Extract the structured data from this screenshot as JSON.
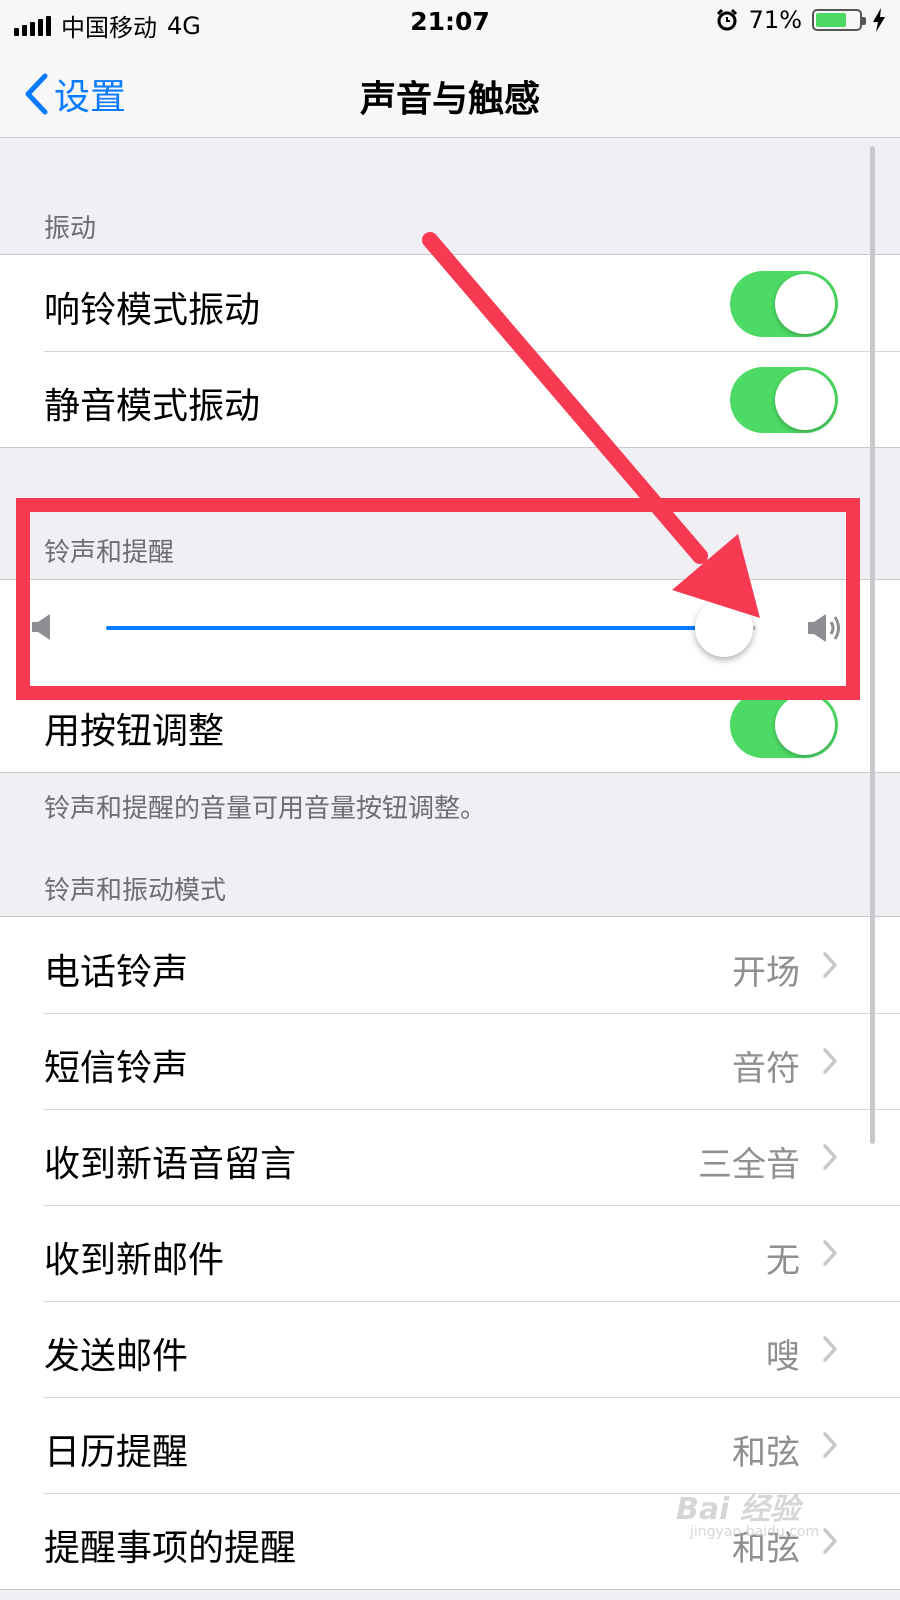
{
  "status_bar": {
    "carrier": "中国移动",
    "network": "4G",
    "time": "21:07",
    "battery_percent": "71%",
    "battery_level": 0.71
  },
  "nav": {
    "back_label": "设置",
    "title": "声音与触感"
  },
  "sections": {
    "vibrate": {
      "header": "振动",
      "rows": [
        {
          "label": "响铃模式振动",
          "on": true
        },
        {
          "label": "静音模式振动",
          "on": true
        }
      ]
    },
    "ringer": {
      "header": "铃声和提醒",
      "volume_level": 0.95,
      "adjust_row": {
        "label": "用按钮调整",
        "on": true
      },
      "footer": "铃声和提醒的音量可用音量按钮调整。"
    },
    "patterns": {
      "header": "铃声和振动模式",
      "rows": [
        {
          "label": "电话铃声",
          "value": "开场"
        },
        {
          "label": "短信铃声",
          "value": "音符"
        },
        {
          "label": "收到新语音留言",
          "value": "三全音"
        },
        {
          "label": "收到新邮件",
          "value": "无"
        },
        {
          "label": "发送邮件",
          "value": "嗖"
        },
        {
          "label": "日历提醒",
          "value": "和弦"
        },
        {
          "label": "提醒事项的提醒",
          "value": "和弦"
        }
      ]
    }
  },
  "colors": {
    "accent": "#0a7aff",
    "toggle_on": "#4cd964",
    "annotation": "#f73a52"
  },
  "watermark": {
    "brand": "Bai 经验",
    "url": "jingyan.baidu.com"
  }
}
